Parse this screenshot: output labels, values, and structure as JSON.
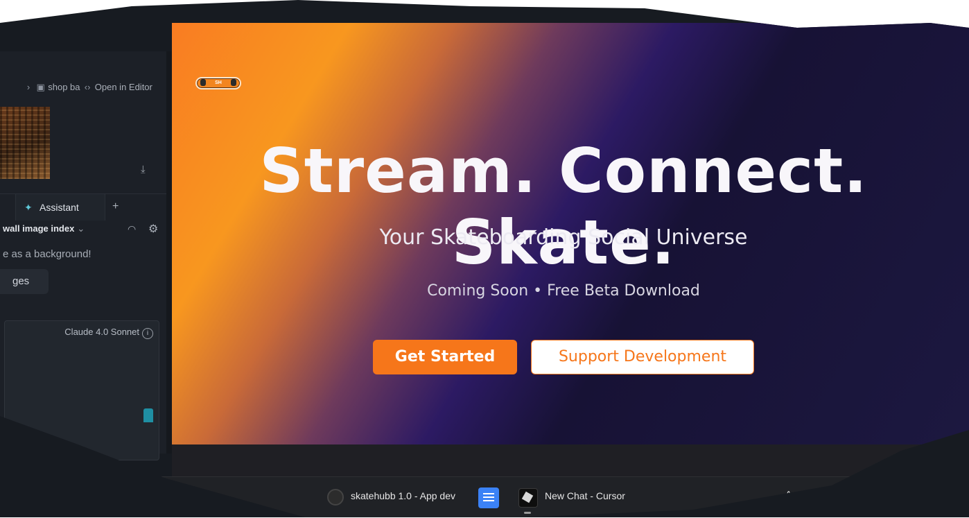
{
  "editor": {
    "breadcrumb_file": "shop ba",
    "breadcrumb_action": "Open in Editor",
    "assistant_tab": "Assistant",
    "add_tab": "+",
    "chat_title": "wall image index",
    "message_text": "e as a background!",
    "chip_label": "ges",
    "model_name": "Claude 4.0 Sonnet",
    "info_glyph": "i"
  },
  "hero": {
    "logo_text": "SH",
    "headline": "Stream. Connect. Skate.",
    "tagline": "Your Skateboarding Social Universe",
    "subtext": "Coming Soon • Free Beta Download",
    "primary_button": "Get Started",
    "secondary_button": "Support Development",
    "accent_color": "#f6761a"
  },
  "taskbar": {
    "item1": "skatehubb 1.0 - App dev",
    "item2": "New Chat - Cursor",
    "caret": "^"
  },
  "icons": [
    "chevron-right-icon",
    "image-icon",
    "code-icon",
    "download-icon",
    "assistant-icon",
    "gauge-icon",
    "gear-icon",
    "chevron-down-icon",
    "info-icon",
    "chrome-icon",
    "docs-icon",
    "cursor-app-icon",
    "caret-up-icon"
  ]
}
